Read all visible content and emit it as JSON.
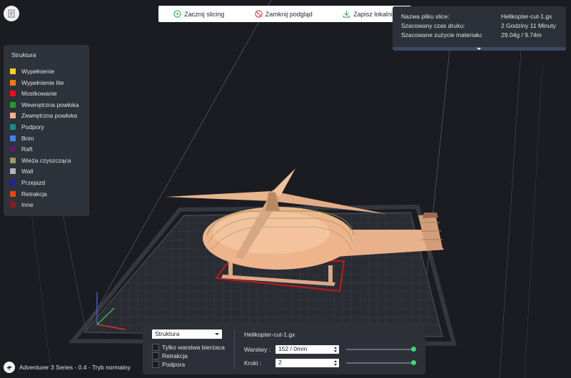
{
  "toolbar": {
    "start_label": "Zacznij slicing",
    "close_label": "Zamknij podgląd",
    "save_label": "Zapisz lokalnie"
  },
  "info": {
    "filename_label": "Nazwa pliku slice:",
    "filename_value": "Helikopter-cut-1.gx",
    "time_label": "Szacowany czas druku:",
    "time_value": "2 Godziny 11 Minuty",
    "material_label": "Szacowane zużycie materiału:",
    "material_value": "29.04g / 9.74m"
  },
  "legend": {
    "title": "Struktura",
    "items": [
      {
        "label": "Wypełnienie",
        "color": "#ffd21a"
      },
      {
        "label": "Wypełnienie lite",
        "color": "#f07d12"
      },
      {
        "label": "Mostkowanie",
        "color": "#e81410"
      },
      {
        "label": "Wewnętrzna powłoka",
        "color": "#1fa01f"
      },
      {
        "label": "Zewnętrzna powłoka",
        "color": "#f5b388"
      },
      {
        "label": "Podpory",
        "color": "#168a8c"
      },
      {
        "label": "Brim",
        "color": "#3a86e8"
      },
      {
        "label": "Raft",
        "color": "#5c1b6e"
      },
      {
        "label": "Wieża czyszcząca",
        "color": "#9a9a5e"
      },
      {
        "label": "Wall",
        "color": "#b4b4b4"
      },
      {
        "label": "Przejazd",
        "color": "#23239a"
      },
      {
        "label": "Retrakcja",
        "color": "#e8470e"
      },
      {
        "label": "Inne",
        "color": "#8e1c1c"
      }
    ]
  },
  "bottom": {
    "structure_select": "Struktura",
    "only_current_layer": "Tylko warstwa bierzaca",
    "retraction": "Retrakcja",
    "path": "Podpora",
    "filename": "Helikopter-cut-1.gx",
    "layers_label": "Warstwy :",
    "layers_value": "152 / 0mm",
    "steps_label": "Kroki :",
    "steps_value": "2"
  },
  "status": {
    "printer": "Adventurer 3 Series - 0.4 - Tryb normalny"
  },
  "colors": {
    "background": "#1b1c22",
    "panel": "#2e323a",
    "accent_green": "#2ee06a",
    "model_skin": "#f0b88e"
  }
}
